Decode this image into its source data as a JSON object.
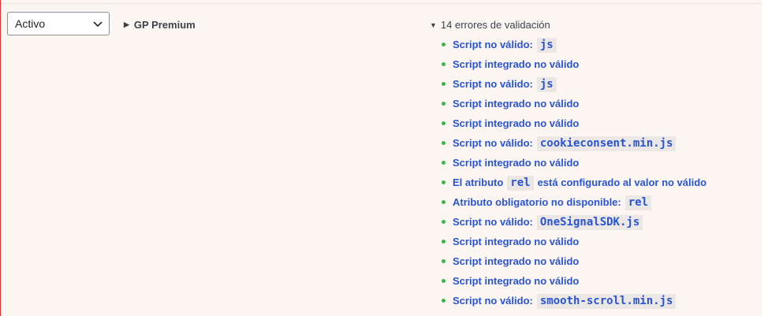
{
  "status_select": {
    "value": "Activo"
  },
  "plugin": {
    "name": "GP Premium",
    "expanded": false
  },
  "errors": {
    "summary": "14 errores de validación",
    "expanded": true,
    "items": [
      {
        "text": "Script no válido:",
        "code": "js",
        "after": ""
      },
      {
        "text": "Script integrado no válido",
        "code": "",
        "after": ""
      },
      {
        "text": "Script no válido:",
        "code": "js",
        "after": ""
      },
      {
        "text": "Script integrado no válido",
        "code": "",
        "after": ""
      },
      {
        "text": "Script integrado no válido",
        "code": "",
        "after": ""
      },
      {
        "text": "Script no válido:",
        "code": "cookieconsent.min.js",
        "after": ""
      },
      {
        "text": "Script integrado no válido",
        "code": "",
        "after": ""
      },
      {
        "text": "El atributo",
        "code": "rel",
        "after": "está configurado al valor no válido"
      },
      {
        "text": "Atributo obligatorio no disponible:",
        "code": "rel",
        "after": ""
      },
      {
        "text": "Script no válido:",
        "code": "OneSignalSDK.js",
        "after": ""
      },
      {
        "text": "Script integrado no válido",
        "code": "",
        "after": ""
      },
      {
        "text": "Script integrado no válido",
        "code": "",
        "after": ""
      },
      {
        "text": "Script integrado no válido",
        "code": "",
        "after": ""
      },
      {
        "text": "Script no válido:",
        "code": "smooth-scroll.min.js",
        "after": ""
      }
    ]
  },
  "colors": {
    "panel_bg": "#fcf6f2",
    "error_border": "#d63638",
    "link": "#2a54d1",
    "bullet": "#3fb34f",
    "code_bg": "#ebe7e5"
  },
  "icons": {
    "select_chevron": "chevron-down-icon",
    "collapsed_toggle": "triangle-right-icon",
    "expanded_toggle": "triangle-down-icon",
    "bullet": "bullet-dot-icon"
  }
}
